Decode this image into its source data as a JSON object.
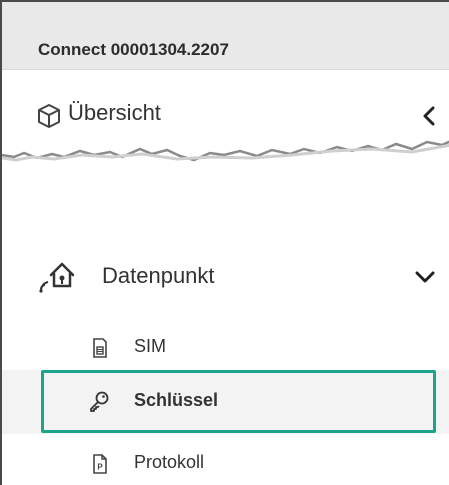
{
  "header": {
    "title": "Connect 00001304.2207"
  },
  "nav": {
    "overview": {
      "label": "Übersicht",
      "icon": "cube-icon",
      "toggle_icon": "chevron-left-icon"
    },
    "datapoint": {
      "label": "Datenpunkt",
      "icon": "smart-home-icon",
      "toggle_icon": "chevron-down-icon",
      "items": [
        {
          "label": "SIM",
          "icon": "sim-card-icon"
        },
        {
          "label": "Schlüssel",
          "icon": "key-icon",
          "active": true
        },
        {
          "label": "Protokoll",
          "icon": "protocol-document-icon"
        }
      ]
    }
  },
  "colors": {
    "highlight": "#1aa58a",
    "header_bg": "#e9e9e9"
  }
}
